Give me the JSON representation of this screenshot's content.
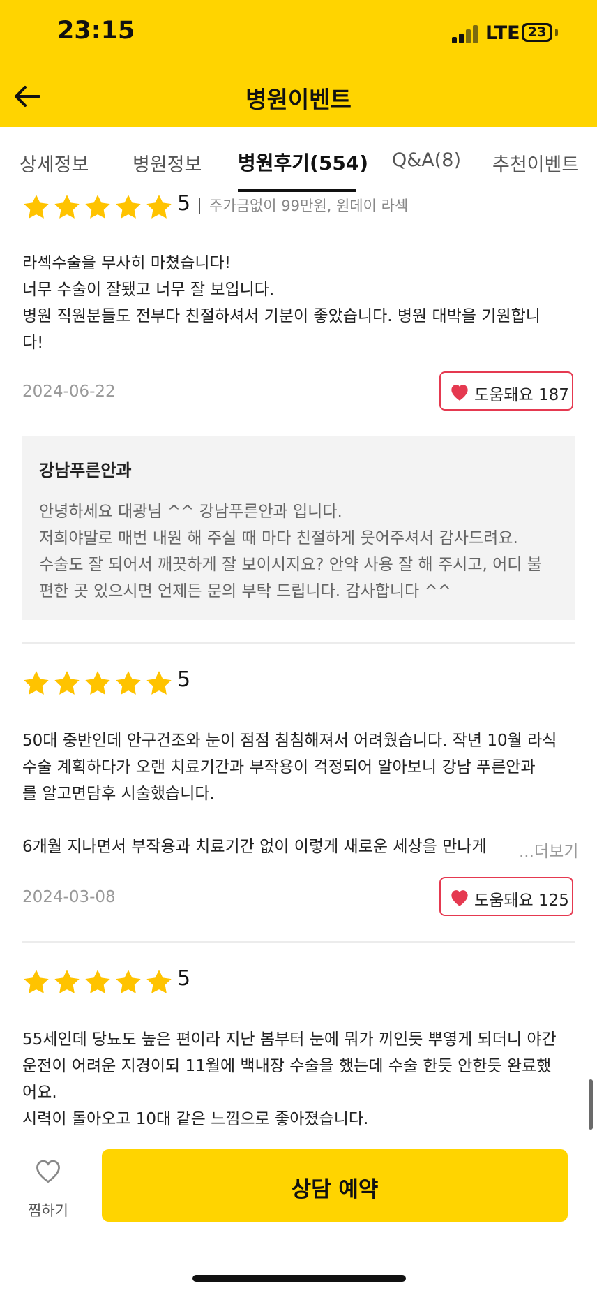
{
  "status_bar": {
    "time": "23:15",
    "network": "LTE",
    "battery": "23"
  },
  "header": {
    "title": "병원이벤트"
  },
  "tabs": [
    {
      "label": "상세정보",
      "active": false
    },
    {
      "label": "병원정보",
      "active": false
    },
    {
      "label": "병원후기(554)",
      "active": true
    },
    {
      "label": "Q&A(8)",
      "active": false
    },
    {
      "label": "추천이벤트",
      "active": false
    }
  ],
  "reviews": [
    {
      "rating": "5",
      "option": "주가금없이 99만원, 원데이 라섹",
      "text_lines": [
        "라섹수술을 무사히 마쳤습니다!",
        "너무 수술이 잘됐고 너무 잘 보입니다.",
        "병원 직원분들도 전부다 친절하셔서 기분이 좋았습니다. 병원 대박을 기원합니",
        "다!"
      ],
      "date": "2024-06-22",
      "helpful_label": "도움돼요 187",
      "reply": {
        "name": "강남푸른안과",
        "text_lines": [
          "안녕하세요 대광님 ^^ 강남푸른안과 입니다.",
          "저희야말로 매번 내원 해 주실 때 마다 친절하게 웃어주셔서 감사드려요.",
          "수술도 잘 되어서 깨끗하게 잘 보이시지요? 안약 사용 잘 해 주시고, 어디 불",
          "편한 곳 있으시면 언제든 문의 부탁 드립니다. 감사합니다 ^^"
        ]
      }
    },
    {
      "rating": "5",
      "text_lines": [
        "50대 중반인데 안구건조와 눈이 점점 침침해져서 어려웠습니다. 작년 10월 라식",
        "수술 계획하다가 오랜 치료기간과 부작용이 걱정되어 알아보니 강남 푸른안과",
        "를 알고면담후 시술했습니다.",
        "",
        "6개월 지나면서 부작용과 치료기간 없이 이렇게 새로운 세상을 만나게"
      ],
      "more_label": "...더보기",
      "date": "2024-03-08",
      "helpful_label": "도움돼요 125"
    },
    {
      "rating": "5",
      "text_lines": [
        "55세인데 당뇨도 높은 편이라 지난 봄부터 눈에 뭐가 끼인듯 뿌옇게 되더니 야간",
        "운전이 어려운 지경이되 11월에 백내장 수술을 했는데 수술 한듯 안한듯 완료했",
        "어요.",
        "시력이 돌아오고 10대 같은 느낌으로 좋아졌습니다."
      ]
    }
  ],
  "bottom_bar": {
    "wish_label": "찜하기",
    "consult_label": "상담 예약"
  },
  "colors": {
    "brand_yellow": "#FFD400",
    "heart_red": "#E53950",
    "star_yellow": "#FFC300"
  },
  "icons": {
    "back": "arrow-left",
    "heart": "heart-filled",
    "wish": "heart-outline",
    "star": "star-filled"
  }
}
